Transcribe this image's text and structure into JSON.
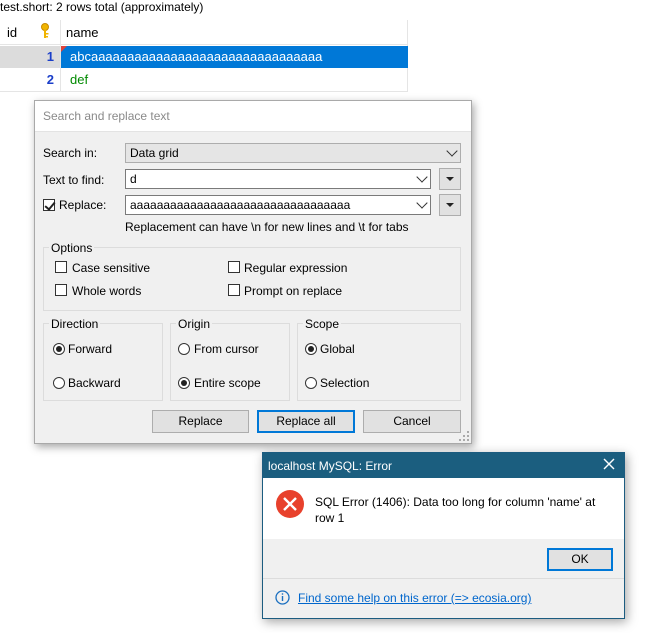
{
  "grid": {
    "title": "test.short: 2 rows total (approximately)",
    "columns": [
      "id",
      "name"
    ],
    "key_icon": "key-icon",
    "rows": [
      {
        "id": "1",
        "name": "abcaaaaaaaaaaaaaaaaaaaaaaaaaaaaaaaa"
      },
      {
        "id": "2",
        "name": "def"
      }
    ]
  },
  "search_dialog": {
    "title": "Search and replace text",
    "search_in_label": "Search in:",
    "search_in_value": "Data grid",
    "text_to_find_label": "Text to find:",
    "text_to_find_value": "d",
    "replace_label": "Replace:",
    "replace_checked": true,
    "replace_value": "aaaaaaaaaaaaaaaaaaaaaaaaaaaaaaaaa",
    "replace_hint": "Replacement can have \\n for new lines and \\t for tabs",
    "options_label": "Options",
    "options": {
      "case_sensitive": "Case sensitive",
      "regular_expression": "Regular expression",
      "whole_words": "Whole words",
      "prompt_on_replace": "Prompt on replace"
    },
    "direction": {
      "label": "Direction",
      "forward": "Forward",
      "backward": "Backward",
      "selected": "forward"
    },
    "origin": {
      "label": "Origin",
      "from_cursor": "From cursor",
      "entire_scope": "Entire scope",
      "selected": "entire_scope"
    },
    "scope": {
      "label": "Scope",
      "global": "Global",
      "selection": "Selection",
      "selected": "global"
    },
    "buttons": {
      "replace": "Replace",
      "replace_all": "Replace all",
      "cancel": "Cancel"
    }
  },
  "error_dialog": {
    "title": "localhost MySQL: Error",
    "message": "SQL Error (1406): Data too long for column 'name' at row 1",
    "ok_label": "OK",
    "help_link": "Find some help on this error (=> ecosia.org)"
  },
  "colors": {
    "selection": "#0078d7",
    "error_titlebar": "#1b5e7f",
    "row_id": "#1a3ec9",
    "def_text": "#008a00"
  }
}
